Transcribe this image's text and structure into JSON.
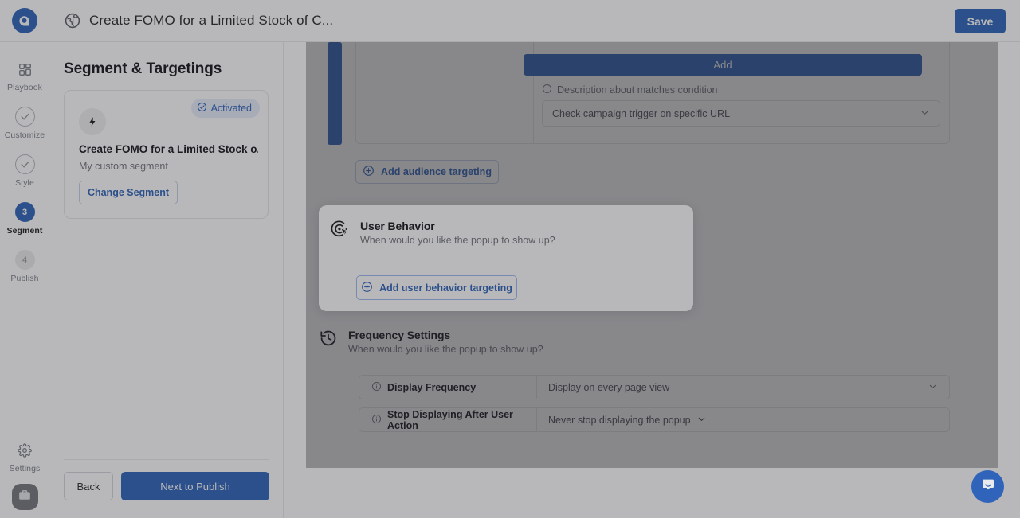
{
  "topbar": {
    "logo_icon": "chat-bubble-logo-icon",
    "page_icon": "globe-icon",
    "title": "Create FOMO for a Limited Stock of C...",
    "save_label": "Save"
  },
  "rail": {
    "items": [
      {
        "label": "Playbook",
        "icon": "grid-icon",
        "state": "default"
      },
      {
        "label": "Customize",
        "icon": "check-circle-icon",
        "state": "done"
      },
      {
        "label": "Style",
        "icon": "check-circle-icon",
        "state": "done"
      },
      {
        "label": "Segment",
        "icon": "step-number",
        "step": "3",
        "state": "active"
      },
      {
        "label": "Publish",
        "icon": "step-number",
        "step": "4",
        "state": "upcoming"
      }
    ],
    "settings": {
      "label": "Settings",
      "icon": "gear-icon"
    },
    "avatar_icon": "briefcase-avatar-icon"
  },
  "left_panel": {
    "title": "Segment & Targetings",
    "segment_card": {
      "badge_label": "Activated",
      "badge_icon": "check-circle-icon",
      "avatar_icon": "lightning-bolt-icon",
      "name": "Create FOMO for a Limited Stock o...",
      "subtitle": "My custom segment",
      "change_label": "Change Segment"
    },
    "back_label": "Back",
    "next_label": "Next to Publish"
  },
  "content": {
    "condition_block": {
      "add_label": "Add",
      "description": "Description about matches condition",
      "description_icon": "info-icon",
      "url_select_value": "Check campaign trigger on specific URL",
      "url_select_icon": "chevron-down-icon"
    },
    "add_audience_label": "Add audience targeting",
    "add_audience_icon": "plus-circle-icon",
    "user_behavior": {
      "icon": "cursor-click-target-icon",
      "title": "User Behavior",
      "subtitle": "When would you like the popup to show up?",
      "add_label": "Add user behavior targeting",
      "add_icon": "plus-circle-icon"
    },
    "frequency": {
      "icon": "history-clock-icon",
      "title": "Frequency Settings",
      "subtitle": "When would you like the popup to show up?",
      "rows": [
        {
          "icon": "info-icon",
          "label": "Display Frequency",
          "value": "Display on every page view",
          "chevron": "chevron-down-icon",
          "chevron_position": "right"
        },
        {
          "icon": "info-icon",
          "label": "Stop Displaying After User Action",
          "value": "Never stop displaying the popup",
          "chevron": "chevron-down-icon",
          "chevron_position": "inline"
        }
      ]
    }
  },
  "chat_widget": {
    "icon": "chat-bubble-icon"
  },
  "colors": {
    "primary": "#2f64ba",
    "text": "#15171a",
    "muted": "#73767d",
    "border": "#e4e5e9",
    "overlay": "rgba(38,40,46,0.33)"
  }
}
